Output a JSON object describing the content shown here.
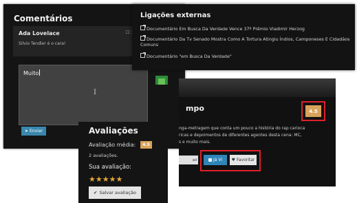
{
  "comments": {
    "title": "Comentários",
    "item": {
      "author": "Ada Lovelace",
      "text": "Silvio Tendler é o cara!",
      "date": "☐ 18"
    },
    "input_value": "Muito",
    "send_label": "Enviar",
    "send_icon": "paper-plane-icon"
  },
  "links": {
    "title": "Ligações externas",
    "items": [
      "Documentário Em Busca Da Verdade Vence 37º Prêmio Vladimir Herzog",
      "Documentário Da Tv Senado Mostra Como A Tortura Atingiu Índios, Camponeses E Cidadãos",
      "Comuns",
      "Documentário \"em Busca Da Verdade\""
    ],
    "icon": "external-link-icon"
  },
  "film": {
    "title_fragment": "mpo",
    "rating": "4.5",
    "description_lines": [
      "nga-metragem que conta um pouco a história do rap carioca",
      "ricas e depoimentos de diferentes agentes desta cena: MC,",
      "s e muito mais."
    ],
    "left_button": "ad",
    "seen_label": "Já Vi",
    "fav_label": "Favoritar",
    "accent": "#e0202a"
  },
  "ratings": {
    "title": "Avaliações",
    "average_label": "Avaliação média:",
    "average_value": "4.5",
    "count_text": "2 avaliações.",
    "your_label": "Sua avaliação:",
    "stars": 5,
    "stars_text": "★★★★★",
    "save_label": "Salvar avaliação",
    "save_icon": "check-icon",
    "badge_color": "#d9a35c"
  }
}
